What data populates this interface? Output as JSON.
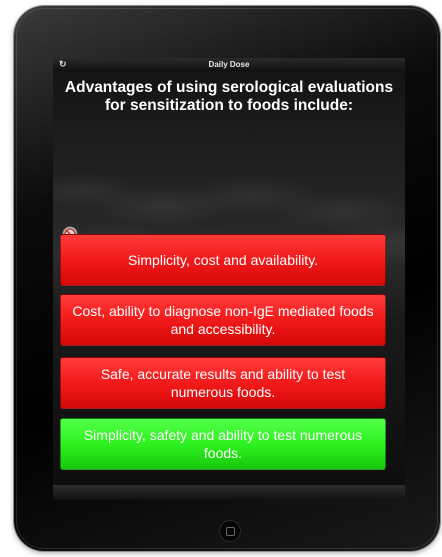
{
  "app": {
    "title": "Daily Dose",
    "refresh_icon": "refresh-icon"
  },
  "question": {
    "text": "Advantages of using serological evaluations for sensitization to foods include:"
  },
  "answers": [
    {
      "label": "Simplicity, cost and availability.",
      "color": "#f21a1a"
    },
    {
      "label": "Cost, ability to diagnose non-IgE mediated foods and accessibility.",
      "color": "#f21a1a"
    },
    {
      "label": "Safe, accurate results and ability to test numerous foods.",
      "color": "#f21a1a"
    },
    {
      "label": "Simplicity, safety and ability to test numerous foods.",
      "color": "#2ef21f"
    }
  ],
  "icons": {
    "no_entry": "no-entry-icon",
    "home": "home-button-icon"
  }
}
